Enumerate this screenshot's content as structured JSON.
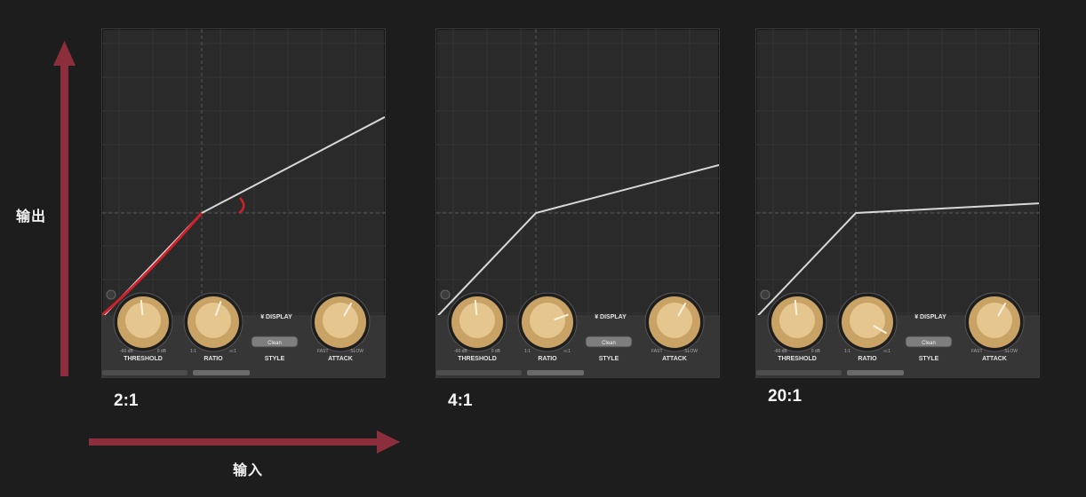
{
  "axes": {
    "y_label": "输出",
    "x_label": "输入",
    "arrow_color": "#8c2e3b"
  },
  "panels": [
    {
      "ratio_caption": "2:1",
      "ratio_value": 2,
      "annotation_color": "#d0202a",
      "controls": {
        "threshold": {
          "label": "THRESHOLD",
          "min": "-60 dB",
          "max": "0 dB"
        },
        "ratio": {
          "label": "RATIO",
          "min": "1:1",
          "max": "∞:1"
        },
        "display": "DISPLAY",
        "style": {
          "button": "Clean",
          "label": "STYLE"
        },
        "attack": {
          "label": "ATTACK",
          "min": "FAST",
          "max": "SLOW"
        }
      }
    },
    {
      "ratio_caption": "4:1",
      "ratio_value": 4,
      "controls": {
        "threshold": {
          "label": "THRESHOLD",
          "min": "-60 dB",
          "max": "0 dB"
        },
        "ratio": {
          "label": "RATIO",
          "min": "1:1",
          "max": "∞:1"
        },
        "display": "DISPLAY",
        "style": {
          "button": "Clean",
          "label": "STYLE"
        },
        "attack": {
          "label": "ATTACK",
          "min": "FAST",
          "max": "SLOW"
        }
      }
    },
    {
      "ratio_caption": "20:1",
      "ratio_value": 20,
      "controls": {
        "threshold": {
          "label": "THRESHOLD",
          "min": "-60 dB",
          "max": "0 dB"
        },
        "ratio": {
          "label": "RATIO",
          "min": "1:1",
          "max": "∞:1"
        },
        "display": "DISPLAY",
        "style": {
          "button": "Clean",
          "label": "STYLE"
        },
        "attack": {
          "label": "ATTACK",
          "min": "FAST",
          "max": "SLOW"
        }
      }
    }
  ]
}
